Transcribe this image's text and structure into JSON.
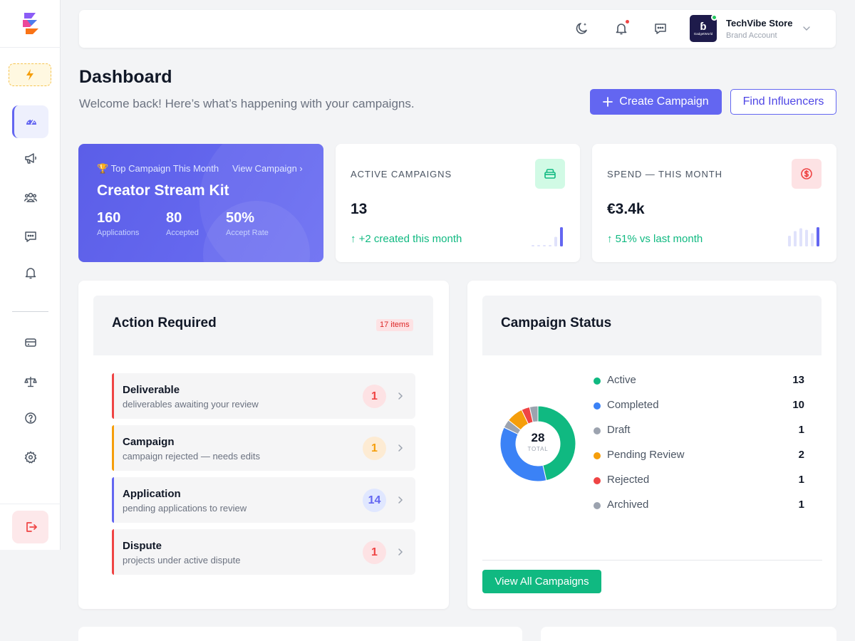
{
  "header": {
    "store_name": "TechVibe Store",
    "store_sub": "Brand Account",
    "avatar_initial": "ɓ",
    "avatar_sub": "GadgetWorld"
  },
  "page": {
    "title": "Dashboard",
    "subtitle": "Welcome back! Here’s what’s happening with your campaigns.",
    "create_button": "Create Campaign",
    "find_button": "Find Influencers"
  },
  "top_campaign": {
    "label": "🏆 Top Campaign This Month",
    "link": "View Campaign ›",
    "name": "Creator Stream Kit",
    "stats": [
      {
        "value": "160",
        "label": "Applications"
      },
      {
        "value": "80",
        "label": "Accepted"
      },
      {
        "value": "50%",
        "label": "Accept Rate"
      }
    ]
  },
  "active_campaigns": {
    "label": "ACTIVE CAMPAIGNS",
    "value": "13",
    "change": "↑  +2 created this month",
    "spark": [
      0.05,
      0.05,
      0.05,
      0.05,
      0.45,
      0.9
    ]
  },
  "spend": {
    "label": "SPEND — THIS MONTH",
    "value": "€3.4k",
    "change": "↑  51% vs last month",
    "spark": [
      0.5,
      0.72,
      0.85,
      0.78,
      0.62,
      0.9
    ]
  },
  "action_required": {
    "title": "Action Required",
    "badge": "17 items",
    "items": [
      {
        "title": "Deliverable",
        "desc": "deliverables awaiting your review",
        "count": "1"
      },
      {
        "title": "Campaign",
        "desc": "campaign rejected — needs edits",
        "count": "1"
      },
      {
        "title": "Application",
        "desc": "pending applications to review",
        "count": "14"
      },
      {
        "title": "Dispute",
        "desc": "projects under active dispute",
        "count": "1"
      }
    ]
  },
  "campaign_status": {
    "title": "Campaign Status",
    "total": "28",
    "total_label": "TOTAL",
    "items": [
      {
        "name": "Active",
        "count": "13",
        "color": "#10b981"
      },
      {
        "name": "Completed",
        "count": "10",
        "color": "#3b82f6"
      },
      {
        "name": "Draft",
        "count": "1",
        "color": "#9ca3af"
      },
      {
        "name": "Pending Review",
        "count": "2",
        "color": "#f59e0b"
      },
      {
        "name": "Rejected",
        "count": "1",
        "color": "#ef4444"
      },
      {
        "name": "Archived",
        "count": "1",
        "color": "#9ca3af"
      }
    ],
    "view_all": "View All Campaigns"
  },
  "colors": {
    "primary": "#6366f1",
    "success": "#10b981",
    "danger": "#ef4444",
    "warning": "#f59e0b"
  }
}
